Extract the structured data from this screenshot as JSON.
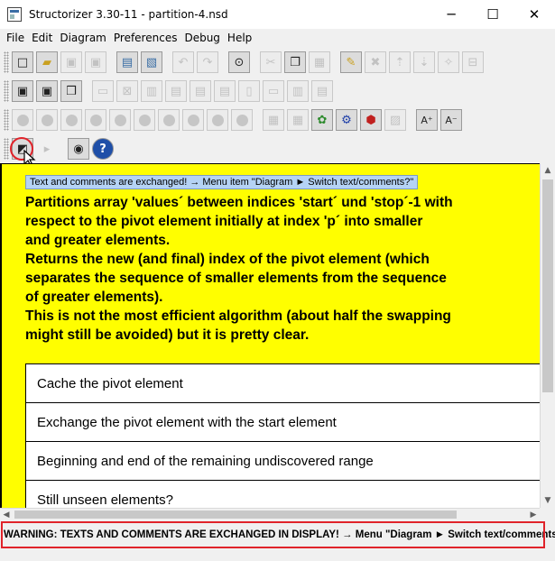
{
  "window": {
    "title": "Structorizer 3.30-11 - partition-4.nsd",
    "minimize_glyph": "─",
    "maximize_glyph": "☐",
    "close_glyph": "✕"
  },
  "menu": [
    "File",
    "Edit",
    "Diagram",
    "Preferences",
    "Debug",
    "Help"
  ],
  "toolbars": {
    "row1_icons": [
      "new-file-icon",
      "open-file-icon",
      "save-icon",
      "save-all-icon",
      "print-icon",
      "export-picture-icon",
      "undo-icon",
      "redo-icon",
      "find-icon",
      "cut-icon",
      "copy-icon",
      "paste-icon",
      "edit-element-icon",
      "delete-icon",
      "move-up-icon",
      "move-down-icon",
      "transmute-icon",
      "collapse-icon"
    ],
    "row2_icons": [
      "add-main-icon",
      "add-sub-icon",
      "add-include-icon",
      "instruction-icon",
      "alternative-icon",
      "case-icon",
      "for-icon",
      "while-icon",
      "repeat-icon",
      "call-icon",
      "jump-icon",
      "parallel-icon",
      "try-icon"
    ],
    "row3_icons": [
      "color-0-icon",
      "color-1-icon",
      "color-2-icon",
      "color-3-icon",
      "color-4-icon",
      "color-5-icon",
      "color-6-icon",
      "color-7-icon",
      "color-8-icon",
      "color-9-icon",
      "arrange-icon",
      "turtle-icon",
      "executor-icon",
      "analyser-icon",
      "code-preview-icon",
      "font-up-icon",
      "font-down-icon"
    ],
    "row4_icons": [
      "switch-text-comments-icon",
      "comments-popup-icon",
      "view-eye-icon",
      "help-icon"
    ]
  },
  "diagram": {
    "tooltip": "Text and comments are exchanged! → Menu item \"Diagram ► Switch text/comments?\"",
    "comment_lines": [
      "Partitions array 'values´ between indices 'start´ und 'stop´-1 with",
      "respect to the pivot element initially at index 'p´ into smaller",
      "and greater elements.",
      "Returns the new (and final) index of the pivot element (which",
      "separates the sequence of smaller elements from the sequence",
      "of greater elements).",
      "This is not the most efficient algorithm (about half the swapping",
      "might still be avoided) but it is pretty clear."
    ],
    "steps": [
      "Cache the pivot element",
      "Exchange the pivot element with the start element",
      "Beginning and end of the remaining undiscovered range",
      "Still unseen elements?"
    ],
    "background_color": "#fffe00"
  },
  "status": {
    "warning": "WARNING: TEXTS AND COMMENTS ARE EXCHANGED IN DISPLAY! → Menu \"Diagram ► Switch text/comments\"."
  },
  "colors": {
    "highlight_red": "#e0232a",
    "tooltip_bg": "#b5d3f5"
  }
}
